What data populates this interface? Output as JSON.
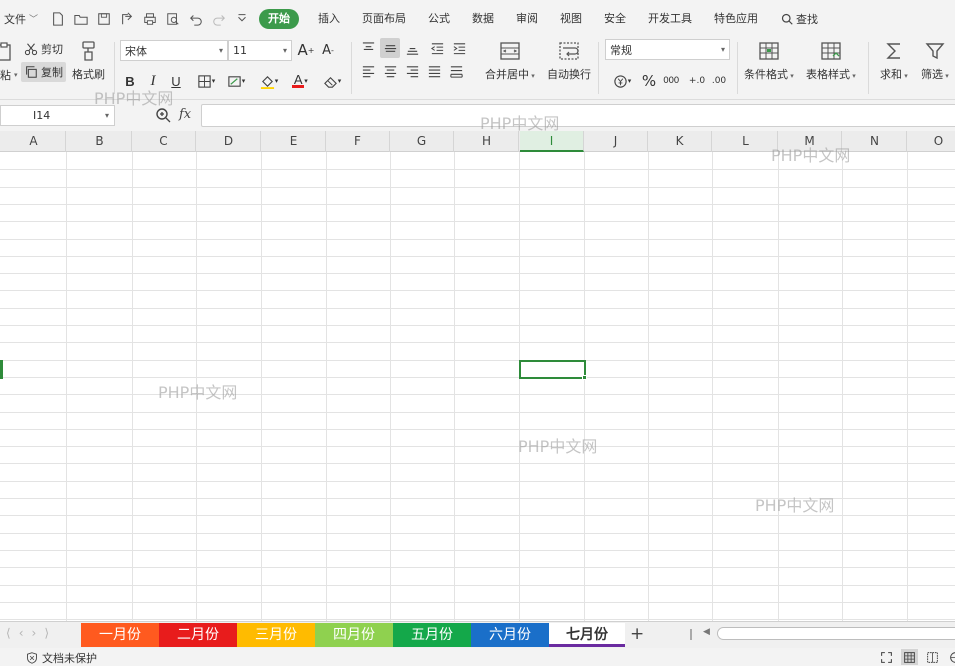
{
  "menubar": {
    "file_label": "文件",
    "tabs": [
      {
        "label": "开始",
        "active": true
      },
      {
        "label": "插入"
      },
      {
        "label": "页面布局"
      },
      {
        "label": "公式"
      },
      {
        "label": "数据"
      },
      {
        "label": "审阅"
      },
      {
        "label": "视图"
      },
      {
        "label": "安全"
      },
      {
        "label": "开发工具"
      },
      {
        "label": "特色应用"
      }
    ],
    "search_label": "查找"
  },
  "ribbon": {
    "paste_label": "粘",
    "cut_label": "剪切",
    "copy_label": "复制",
    "format_painter_label": "格式刷",
    "font_name": "宋体",
    "font_size": "11",
    "bold": "B",
    "italic": "I",
    "underline": "U",
    "font_color_glyph": "A",
    "merge_center_label": "合并居中",
    "wrap_text_label": "自动换行",
    "number_format": "常规",
    "percent_glyph": "%",
    "thousands_glyph": "000",
    "inc_decimal_glyph": "+.0",
    "dec_decimal_glyph": ".00",
    "conditional_format_label": "条件格式",
    "table_style_label": "表格样式",
    "sum_label": "求和",
    "filter_label": "筛选"
  },
  "formula_bar": {
    "cell_ref": "I14",
    "fx_label": "fx",
    "formula_value": ""
  },
  "grid": {
    "columns": [
      "A",
      "B",
      "C",
      "D",
      "E",
      "F",
      "G",
      "H",
      "I",
      "J",
      "K",
      "L",
      "M",
      "N",
      "O"
    ],
    "active_column": "I"
  },
  "watermark_text": "PHP中文网",
  "sheets": [
    {
      "label": "一月份",
      "color": "#ff5a1f"
    },
    {
      "label": "二月份",
      "color": "#e81c1c"
    },
    {
      "label": "三月份",
      "color": "#ffbb00"
    },
    {
      "label": "四月份",
      "color": "#8fd14f"
    },
    {
      "label": "五月份",
      "color": "#14a84a"
    },
    {
      "label": "六月份",
      "color": "#1a6fc9"
    },
    {
      "label": "七月份",
      "color": "#ffffff",
      "active": true
    }
  ],
  "sheet_add_glyph": "+",
  "status": {
    "protect_label": "文档未保护"
  },
  "colors": {
    "accent": "#3c9a4b",
    "selection": "#2e8b3a",
    "active_tab_underline": "#6a2ba0"
  }
}
